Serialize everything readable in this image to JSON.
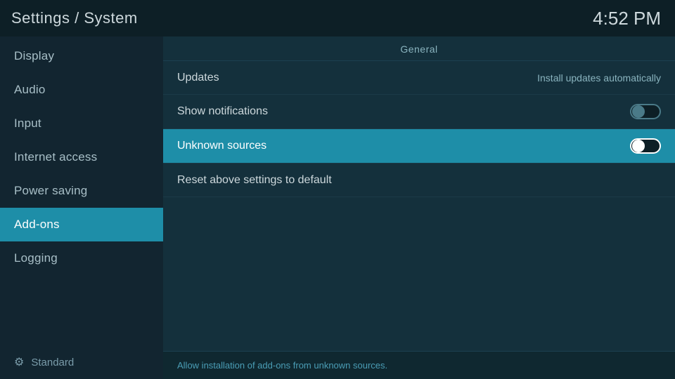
{
  "header": {
    "title": "Settings / System",
    "time": "4:52 PM"
  },
  "sidebar": {
    "items": [
      {
        "id": "display",
        "label": "Display",
        "active": false
      },
      {
        "id": "audio",
        "label": "Audio",
        "active": false
      },
      {
        "id": "input",
        "label": "Input",
        "active": false
      },
      {
        "id": "internet-access",
        "label": "Internet access",
        "active": false
      },
      {
        "id": "power-saving",
        "label": "Power saving",
        "active": false
      },
      {
        "id": "add-ons",
        "label": "Add-ons",
        "active": true
      },
      {
        "id": "logging",
        "label": "Logging",
        "active": false
      }
    ],
    "footer": {
      "icon": "⚙",
      "label": "Standard"
    }
  },
  "content": {
    "section_label": "General",
    "rows": [
      {
        "id": "updates",
        "label": "Updates",
        "value": "Install updates automatically",
        "toggle": null,
        "selected": false
      },
      {
        "id": "show-notifications",
        "label": "Show notifications",
        "value": null,
        "toggle": {
          "on": false
        },
        "selected": false
      },
      {
        "id": "unknown-sources",
        "label": "Unknown sources",
        "value": null,
        "toggle": {
          "on": false
        },
        "selected": true
      },
      {
        "id": "reset-settings",
        "label": "Reset above settings to default",
        "value": null,
        "toggle": null,
        "selected": false
      }
    ],
    "status_text": "Allow installation of add-ons from unknown sources."
  }
}
